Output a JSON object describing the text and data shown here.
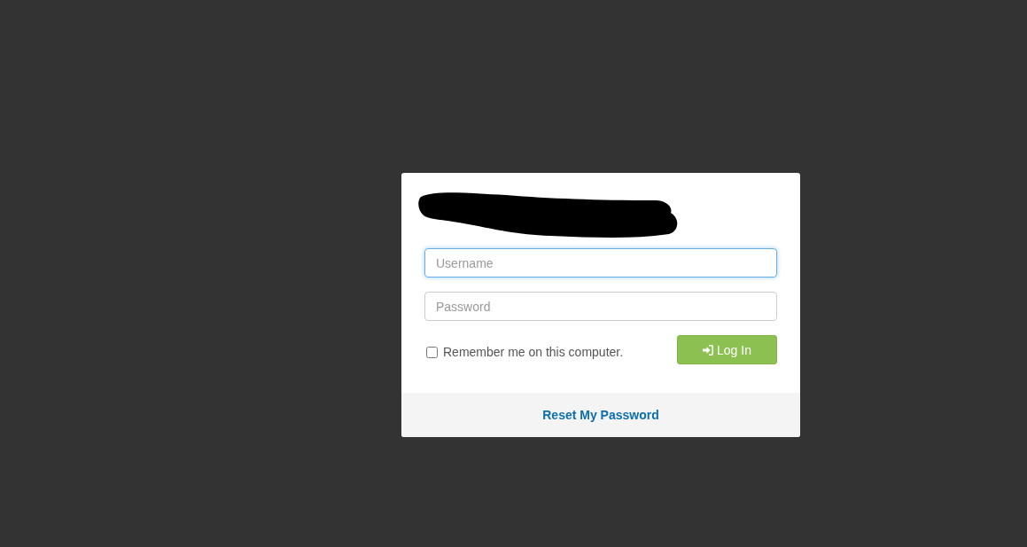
{
  "login_form": {
    "fields": [
      {
        "placeholder": "Username",
        "focused": true
      },
      {
        "placeholder": "Password",
        "focused": false
      }
    ],
    "remember": {
      "label": "Remember me on this computer.",
      "checked": false
    },
    "submit_button": {
      "label": "Log In"
    }
  },
  "footer": {
    "link": "Reset My Password"
  }
}
